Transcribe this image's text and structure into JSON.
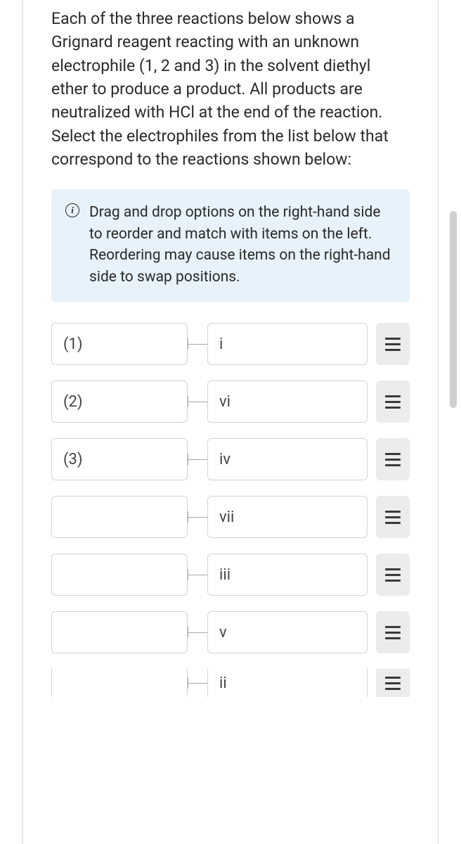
{
  "question": "Each of the three reactions below shows a Grignard reagent reacting with an unknown electrophile (1, 2 and 3) in the solvent diethyl ether to produce a product. All products are neutralized with HCl at the end of the reaction. Select the electrophiles from the list below that correspond to the reactions shown below:",
  "info": {
    "line1": "Drag and drop options on the right-hand side to reorder and match with items on the left.",
    "line2": "Reordering may cause items on the right-hand side to swap positions."
  },
  "rows": [
    {
      "left": "(1)",
      "right": "i"
    },
    {
      "left": "(2)",
      "right": "vi"
    },
    {
      "left": "(3)",
      "right": "iv"
    },
    {
      "left": "",
      "right": "vii"
    },
    {
      "left": "",
      "right": "iii"
    },
    {
      "left": "",
      "right": "v"
    },
    {
      "left": "",
      "right": "ii"
    }
  ]
}
